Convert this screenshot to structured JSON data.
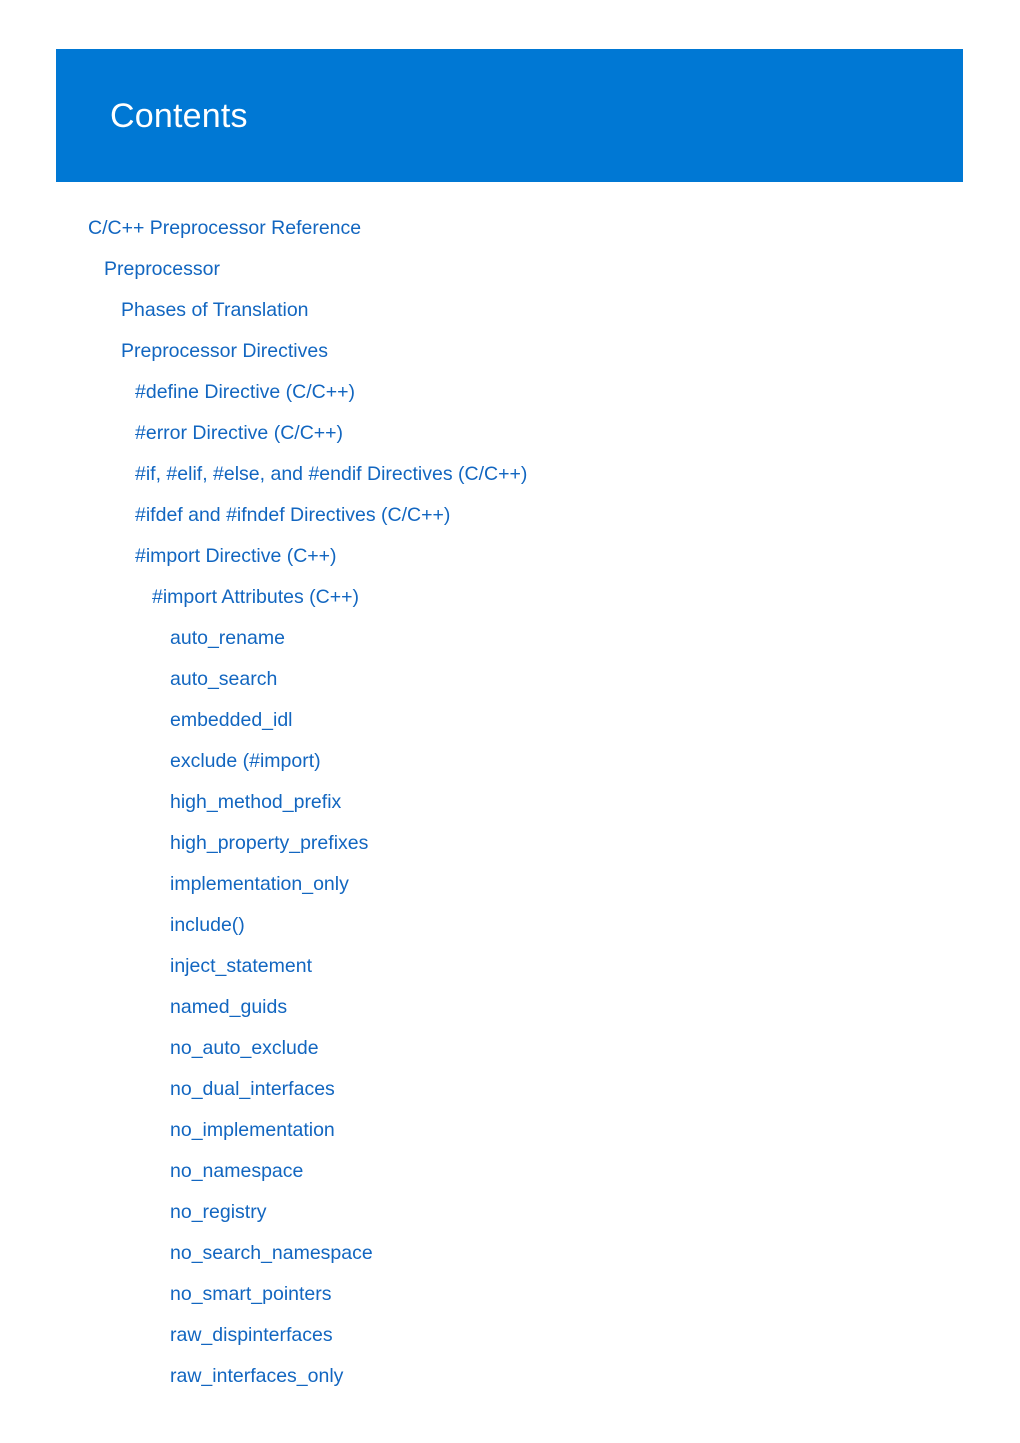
{
  "banner": {
    "title": "Contents",
    "background_color": "#0078d4",
    "title_color": "#ffffff"
  },
  "toc": {
    "link_color": "#1266c0",
    "entries": [
      {
        "label": "C/C++ Preprocessor Reference",
        "level": 0
      },
      {
        "label": "Preprocessor",
        "level": 1
      },
      {
        "label": "Phases of Translation",
        "level": 2
      },
      {
        "label": "Preprocessor Directives",
        "level": 2
      },
      {
        "label": "#define Directive (C/C++)",
        "level": 3
      },
      {
        "label": "#error Directive (C/C++)",
        "level": 3
      },
      {
        "label": "#if, #elif, #else, and #endif Directives (C/C++)",
        "level": 3
      },
      {
        "label": "#ifdef and #ifndef Directives (C/C++)",
        "level": 3
      },
      {
        "label": "#import Directive (C++)",
        "level": 3
      },
      {
        "label": "#import Attributes (C++)",
        "level": 4
      },
      {
        "label": "auto_rename",
        "level": 5
      },
      {
        "label": "auto_search",
        "level": 5
      },
      {
        "label": "embedded_idl",
        "level": 5
      },
      {
        "label": "exclude (#import)",
        "level": 5
      },
      {
        "label": "high_method_prefix",
        "level": 5
      },
      {
        "label": "high_property_prefixes",
        "level": 5
      },
      {
        "label": "implementation_only",
        "level": 5
      },
      {
        "label": "include()",
        "level": 5
      },
      {
        "label": "inject_statement",
        "level": 5
      },
      {
        "label": "named_guids",
        "level": 5
      },
      {
        "label": "no_auto_exclude",
        "level": 5
      },
      {
        "label": "no_dual_interfaces",
        "level": 5
      },
      {
        "label": "no_implementation",
        "level": 5
      },
      {
        "label": "no_namespace",
        "level": 5
      },
      {
        "label": "no_registry",
        "level": 5
      },
      {
        "label": "no_search_namespace",
        "level": 5
      },
      {
        "label": "no_smart_pointers",
        "level": 5
      },
      {
        "label": "raw_dispinterfaces",
        "level": 5
      },
      {
        "label": "raw_interfaces_only",
        "level": 5
      }
    ]
  }
}
